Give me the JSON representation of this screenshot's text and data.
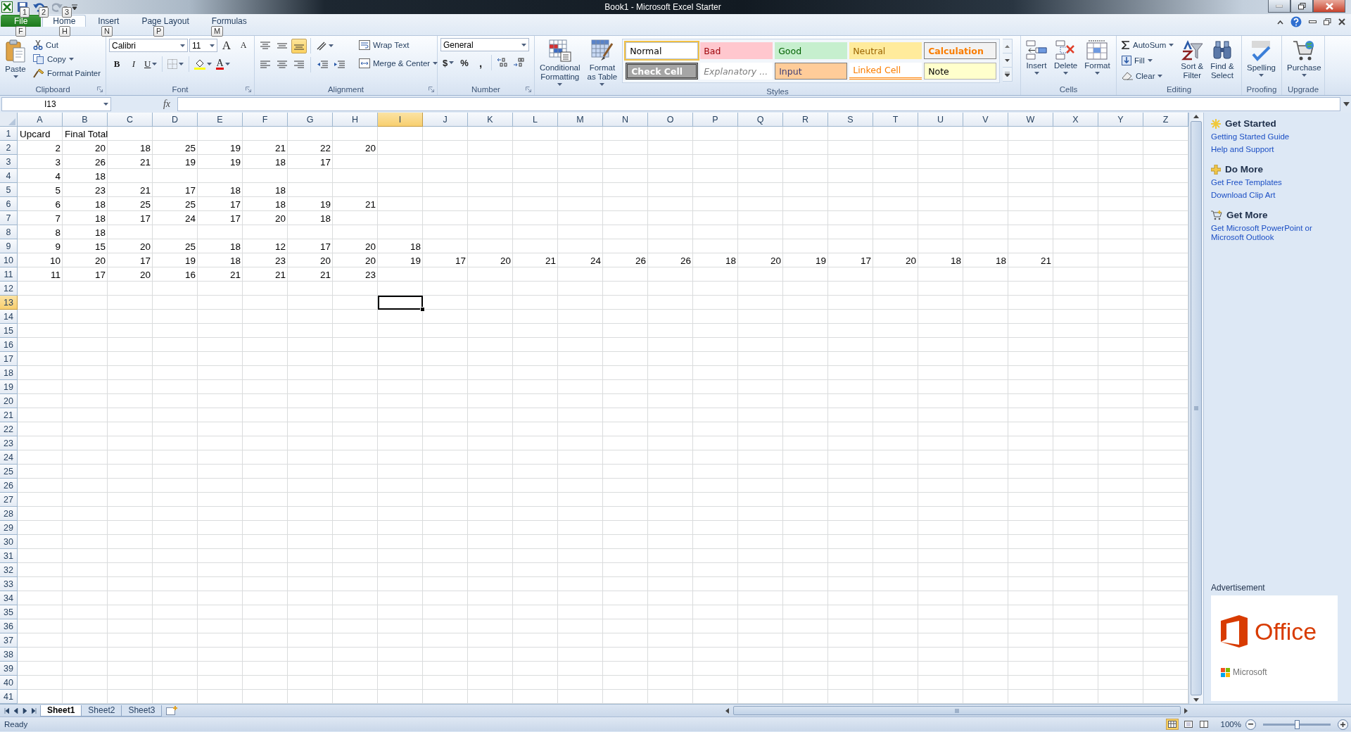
{
  "title_bar": {
    "title": "Book1  -  Microsoft Excel Starter"
  },
  "quick_access": [
    {
      "key_tip": "1"
    },
    {
      "key_tip": "2"
    },
    {
      "key_tip": "3"
    }
  ],
  "tabs": [
    {
      "label": "File",
      "key_tip": "F",
      "selected": false,
      "kind": "file"
    },
    {
      "label": "Home",
      "key_tip": "H",
      "selected": true,
      "kind": "tab"
    },
    {
      "label": "Insert",
      "key_tip": "N",
      "selected": false,
      "kind": "tab"
    },
    {
      "label": "Page Layout",
      "key_tip": "P",
      "selected": false,
      "kind": "tab"
    },
    {
      "label": "Formulas",
      "key_tip": "M",
      "selected": false,
      "kind": "tab"
    }
  ],
  "ribbon": {
    "clipboard": {
      "title": "Clipboard",
      "paste": "Paste",
      "cut": "Cut",
      "copy": "Copy",
      "format_painter": "Format Painter"
    },
    "font": {
      "title": "Font",
      "name": "Calibri",
      "size": "11",
      "grow": "A",
      "shrink": "A",
      "bold": "B",
      "italic": "I",
      "underline": "U",
      "font_color": "A"
    },
    "alignment": {
      "title": "Alignment",
      "wrap_text": "Wrap Text",
      "merge_center": "Merge & Center",
      "vertical": [
        {
          "selected": false
        },
        {
          "selected": false
        },
        {
          "selected": true
        }
      ]
    },
    "number": {
      "title": "Number",
      "format": "General",
      "currency": "$",
      "percent": "%",
      "comma": ","
    },
    "styles": {
      "title": "Styles",
      "conditional": [
        "Conditional",
        "Formatting"
      ],
      "format_table": [
        "Format",
        "as Table"
      ],
      "cells": [
        {
          "label": "Normal",
          "kind": "normal",
          "selected": true
        },
        {
          "label": "Bad",
          "kind": "bad",
          "selected": false
        },
        {
          "label": "Good",
          "kind": "good",
          "selected": false
        },
        {
          "label": "Neutral",
          "kind": "neutral",
          "selected": false
        },
        {
          "label": "Calculation",
          "kind": "calculation",
          "selected": false
        },
        {
          "label": "Check Cell",
          "kind": "check",
          "selected": false
        },
        {
          "label": "Explanatory ...",
          "kind": "explanatory",
          "selected": false
        },
        {
          "label": "Input",
          "kind": "input",
          "selected": false
        },
        {
          "label": "Linked Cell",
          "kind": "linked",
          "selected": false
        },
        {
          "label": "Note",
          "kind": "note",
          "selected": false
        }
      ]
    },
    "cells_group": {
      "title": "Cells",
      "buttons": [
        "Insert",
        "Delete",
        "Format"
      ]
    },
    "editing": {
      "title": "Editing",
      "autosum": "AutoSum",
      "fill": "Fill",
      "clear": "Clear",
      "sort": [
        "Sort &",
        "Filter"
      ],
      "find": [
        "Find &",
        "Select"
      ]
    },
    "proofing": {
      "title": "Proofing",
      "spelling": "Spelling"
    },
    "upgrade": {
      "title": "Upgrade",
      "purchase": "Purchase"
    }
  },
  "formula_bar": {
    "name_box": "I13",
    "function_label": "fx"
  },
  "sheet": {
    "columns": [
      {
        "label": "A",
        "selected": false
      },
      {
        "label": "B",
        "selected": false
      },
      {
        "label": "C",
        "selected": false
      },
      {
        "label": "D",
        "selected": false
      },
      {
        "label": "E",
        "selected": false
      },
      {
        "label": "F",
        "selected": false
      },
      {
        "label": "G",
        "selected": false
      },
      {
        "label": "H",
        "selected": false
      },
      {
        "label": "I",
        "selected": true
      },
      {
        "label": "J",
        "selected": false
      },
      {
        "label": "K",
        "selected": false
      },
      {
        "label": "L",
        "selected": false
      },
      {
        "label": "M",
        "selected": false
      },
      {
        "label": "N",
        "selected": false
      },
      {
        "label": "O",
        "selected": false
      },
      {
        "label": "P",
        "selected": false
      },
      {
        "label": "Q",
        "selected": false
      },
      {
        "label": "R",
        "selected": false
      },
      {
        "label": "S",
        "selected": false
      },
      {
        "label": "T",
        "selected": false
      },
      {
        "label": "U",
        "selected": false
      },
      {
        "label": "V",
        "selected": false
      },
      {
        "label": "W",
        "selected": false
      },
      {
        "label": "X",
        "selected": false
      },
      {
        "label": "Y",
        "selected": false
      },
      {
        "label": "Z",
        "selected": false
      }
    ],
    "rows": [
      {
        "label": "1",
        "selected": false,
        "cells": [
          "Upcard",
          "Final Total"
        ]
      },
      {
        "label": "2",
        "selected": false,
        "cells": [
          "2",
          "20",
          "18",
          "25",
          "19",
          "21",
          "22",
          "20"
        ]
      },
      {
        "label": "3",
        "selected": false,
        "cells": [
          "3",
          "26",
          "21",
          "19",
          "19",
          "18",
          "17"
        ]
      },
      {
        "label": "4",
        "selected": false,
        "cells": [
          "4",
          "18"
        ]
      },
      {
        "label": "5",
        "selected": false,
        "cells": [
          "5",
          "23",
          "21",
          "17",
          "18",
          "18"
        ]
      },
      {
        "label": "6",
        "selected": false,
        "cells": [
          "6",
          "18",
          "25",
          "25",
          "17",
          "18",
          "19",
          "21"
        ]
      },
      {
        "label": "7",
        "selected": false,
        "cells": [
          "7",
          "18",
          "17",
          "24",
          "17",
          "20",
          "18"
        ]
      },
      {
        "label": "8",
        "selected": false,
        "cells": [
          "8",
          "18"
        ]
      },
      {
        "label": "9",
        "selected": false,
        "cells": [
          "9",
          "15",
          "20",
          "25",
          "18",
          "12",
          "17",
          "20",
          "18"
        ]
      },
      {
        "label": "10",
        "selected": false,
        "cells": [
          "10",
          "20",
          "17",
          "19",
          "18",
          "23",
          "20",
          "20",
          "19",
          "17",
          "20",
          "21",
          "24",
          "26",
          "26",
          "18",
          "20",
          "19",
          "17",
          "20",
          "18",
          "18",
          "21"
        ]
      },
      {
        "label": "11",
        "selected": false,
        "cells": [
          "11",
          "17",
          "20",
          "16",
          "21",
          "21",
          "21",
          "23"
        ]
      },
      {
        "label": "12",
        "selected": false
      },
      {
        "label": "13",
        "selected": true
      },
      {
        "label": "14",
        "selected": false
      },
      {
        "label": "15",
        "selected": false
      },
      {
        "label": "16",
        "selected": false
      },
      {
        "label": "17",
        "selected": false
      },
      {
        "label": "18",
        "selected": false
      },
      {
        "label": "19",
        "selected": false
      },
      {
        "label": "20",
        "selected": false
      },
      {
        "label": "21",
        "selected": false
      },
      {
        "label": "22",
        "selected": false
      },
      {
        "label": "23",
        "selected": false
      },
      {
        "label": "24",
        "selected": false
      },
      {
        "label": "25",
        "selected": false
      },
      {
        "label": "26",
        "selected": false
      },
      {
        "label": "27",
        "selected": false
      },
      {
        "label": "28",
        "selected": false
      },
      {
        "label": "29",
        "selected": false
      },
      {
        "label": "30",
        "selected": false
      },
      {
        "label": "31",
        "selected": false
      },
      {
        "label": "32",
        "selected": false
      },
      {
        "label": "33",
        "selected": false
      },
      {
        "label": "34",
        "selected": false
      },
      {
        "label": "35",
        "selected": false
      },
      {
        "label": "36",
        "selected": false
      },
      {
        "label": "37",
        "selected": false
      },
      {
        "label": "38",
        "selected": false
      },
      {
        "label": "39",
        "selected": false
      },
      {
        "label": "40",
        "selected": false
      },
      {
        "label": "41",
        "selected": false
      }
    ]
  },
  "sheet_tabs": [
    {
      "label": "Sheet1",
      "selected": true
    },
    {
      "label": "Sheet2",
      "selected": false
    },
    {
      "label": "Sheet3",
      "selected": false
    }
  ],
  "side_panel": {
    "sections": [
      {
        "title": "Get Started",
        "links": [
          "Getting Started Guide",
          "Help and Support"
        ]
      },
      {
        "title": "Do More",
        "links": [
          "Get Free Templates",
          "Download Clip Art"
        ]
      },
      {
        "title": "Get More",
        "links": [
          "Get Microsoft PowerPoint or Microsoft Outlook"
        ]
      }
    ],
    "advertisement": {
      "label": "Advertisement",
      "product": "Office",
      "brand": "Microsoft"
    }
  },
  "status_bar": {
    "status": "Ready",
    "zoom": {
      "label": "100%",
      "level": 0.5
    }
  }
}
